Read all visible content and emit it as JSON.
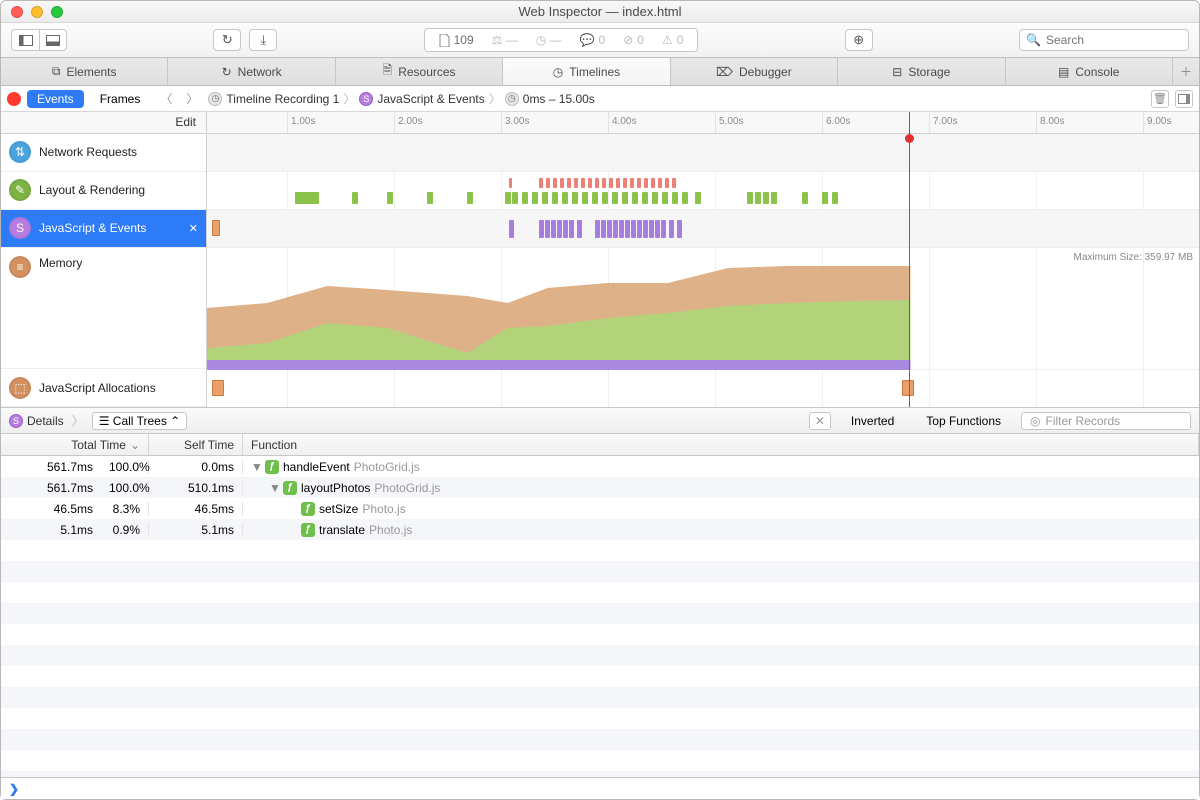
{
  "window": {
    "title": "Web Inspector — index.html"
  },
  "toolbar": {
    "address_count": "109",
    "chat_count": "0",
    "issues_count": "0",
    "warnings_count": "0",
    "search_placeholder": "Search"
  },
  "tabs": [
    "Elements",
    "Network",
    "Resources",
    "Timelines",
    "Debugger",
    "Storage",
    "Console"
  ],
  "tabs_active_index": 3,
  "navbar": {
    "pill_events": "Events",
    "pill_frames": "Frames",
    "crumbs": [
      "Timeline Recording 1",
      "JavaScript & Events",
      "0ms – 15.00s"
    ]
  },
  "sidebar": {
    "edit": "Edit",
    "items": [
      {
        "label": "Network Requests"
      },
      {
        "label": "Layout & Rendering"
      },
      {
        "label": "JavaScript & Events"
      },
      {
        "label": "Memory"
      },
      {
        "label": "JavaScript Allocations"
      }
    ]
  },
  "ruler": {
    "ticks": [
      "1.00s",
      "2.00s",
      "3.00s",
      "4.00s",
      "5.00s",
      "6.00s",
      "7.00s",
      "8.00s",
      "9.00s"
    ]
  },
  "memory": {
    "max_label": "Maximum Size: 359.97 MB"
  },
  "details": {
    "label": "Details",
    "mode": "Call Trees",
    "inverted": "Inverted",
    "top_functions": "Top Functions",
    "filter_placeholder": "Filter Records"
  },
  "table": {
    "headers": {
      "total_time": "Total Time",
      "self_time": "Self Time",
      "function": "Function"
    },
    "rows": [
      {
        "total": "561.7ms",
        "pct": "100.0%",
        "self": "0.0ms",
        "depth": 0,
        "open": true,
        "fn": "handleEvent",
        "file": "PhotoGrid.js"
      },
      {
        "total": "561.7ms",
        "pct": "100.0%",
        "self": "510.1ms",
        "depth": 1,
        "open": true,
        "fn": "layoutPhotos",
        "file": "PhotoGrid.js"
      },
      {
        "total": "46.5ms",
        "pct": "8.3%",
        "self": "46.5ms",
        "depth": 2,
        "open": false,
        "fn": "setSize",
        "file": "Photo.js"
      },
      {
        "total": "5.1ms",
        "pct": "0.9%",
        "self": "5.1ms",
        "depth": 2,
        "open": false,
        "fn": "translate",
        "file": "Photo.js"
      }
    ]
  },
  "console": {
    "prompt": "❯"
  }
}
